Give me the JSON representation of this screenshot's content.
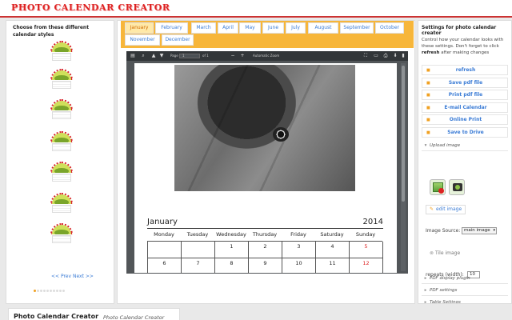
{
  "app": {
    "logo_text": "PHOTO CALENDAR CREATOR"
  },
  "left_panel": {
    "title": "Choose from these different calendar styles",
    "nav_link": "<< Prev Next >>",
    "dots_total": 10,
    "dots_active": 1
  },
  "months": [
    {
      "label": "January",
      "active": true
    },
    {
      "label": "February"
    },
    {
      "label": "March"
    },
    {
      "label": "April"
    },
    {
      "label": "May"
    },
    {
      "label": "June"
    },
    {
      "label": "July"
    },
    {
      "label": "August"
    },
    {
      "label": "September"
    },
    {
      "label": "October"
    },
    {
      "label": "November"
    },
    {
      "label": "December"
    }
  ],
  "pdf_viewer": {
    "page_label": "Page",
    "page_value": "1",
    "page_total": "of 1",
    "zoom": "Automatic Zoom"
  },
  "calendar": {
    "month": "January",
    "year": "2014",
    "days": [
      "Monday",
      "Tuesday",
      "Wednesday",
      "Thursday",
      "Friday",
      "Saturday",
      "Sunday"
    ],
    "week1": [
      "",
      "",
      "1",
      "2",
      "3",
      "4",
      "5"
    ],
    "week2": [
      "6",
      "7",
      "8",
      "9",
      "10",
      "11",
      "12"
    ],
    "sunday_color": "#dd2222"
  },
  "right_panel": {
    "title": "Settings for photo calendar creator",
    "desc_plain": "Control how your calendar looks with these settings. Don't forget to click ",
    "desc_bold": "refresh",
    "desc_end": " after making changes",
    "buttons": [
      {
        "icon": "refresh-icon",
        "label": "refresh"
      },
      {
        "icon": "save-pdf-icon",
        "label": "Save pdf file"
      },
      {
        "icon": "print-icon",
        "label": "Print pdf file"
      },
      {
        "icon": "email-icon",
        "label": "E-mail Calendar"
      },
      {
        "icon": "online-print-icon",
        "label": "Online Print"
      },
      {
        "icon": "drive-icon",
        "label": "Save to Drive"
      }
    ],
    "upload_section": "Upload image",
    "edit_image": "edit image",
    "image_source_label": "Image Source:",
    "image_source_value": "main image",
    "tile_image": "Tile image",
    "repeats_label": "repeats (width):",
    "repeats_value": "10",
    "sections": [
      "PDF display plugin",
      "PDF settings",
      "Table Settings"
    ]
  },
  "footer": {
    "title": "Photo Calendar Creator",
    "subtitle": "Photo Calendar Creator"
  },
  "colors": {
    "accent": "#f7b63a",
    "link": "#3a7bd5",
    "brand_red": "#dd2222"
  }
}
